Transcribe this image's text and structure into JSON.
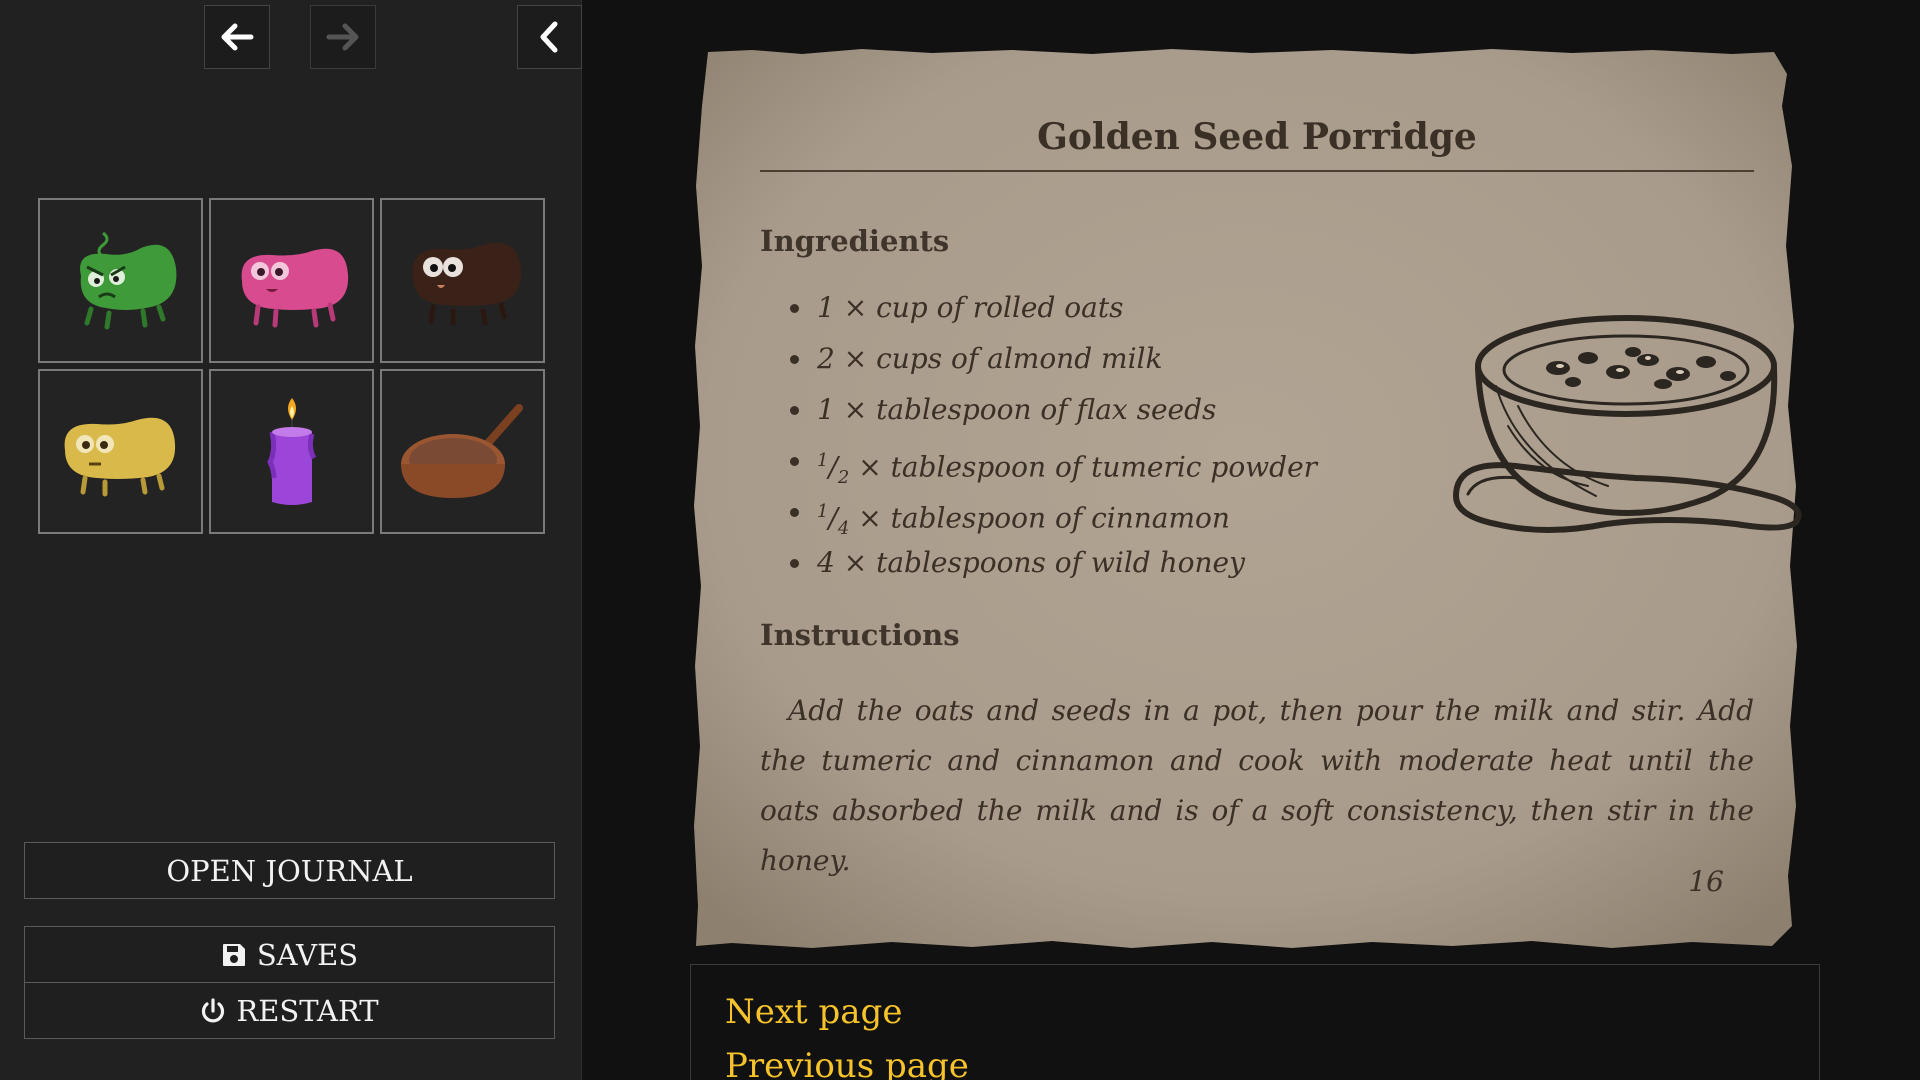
{
  "sidebar": {
    "nav": {
      "back_icon": "arrow-left-icon",
      "forward_icon": "arrow-right-icon",
      "collapse_icon": "chevron-left-icon"
    },
    "inventory": [
      {
        "name": "angry green bean",
        "icon": "green-bean-icon",
        "color": "#3f9a3a"
      },
      {
        "name": "pink bean",
        "icon": "pink-bean-icon",
        "color": "#d84b8f"
      },
      {
        "name": "dark brown bean",
        "icon": "brown-bean-icon",
        "color": "#3a2218"
      },
      {
        "name": "yellow bean",
        "icon": "yellow-bean-icon",
        "color": "#d9b94a"
      },
      {
        "name": "purple candle",
        "icon": "candle-icon",
        "color": "#9b45d9"
      },
      {
        "name": "frying pan",
        "icon": "pan-icon",
        "color": "#9a5630"
      }
    ],
    "buttons": {
      "journal": "OPEN JOURNAL",
      "saves": "SAVES",
      "restart": "RESTART"
    }
  },
  "recipe": {
    "title": "Golden Seed Porridge",
    "ingredients_heading": "Ingredients",
    "ingredients": [
      {
        "qty": "1",
        "rest": " × cup of rolled oats"
      },
      {
        "qty": "2",
        "rest": " × cups of almond milk"
      },
      {
        "qty": "1",
        "rest": " × tablespoon of flax seeds"
      },
      {
        "num": "1",
        "den": "2",
        "rest": " × tablespoon of tumeric powder"
      },
      {
        "num": "1",
        "den": "4",
        "rest": " × tablespoon of cinnamon"
      },
      {
        "qty": "4",
        "rest": " × tablespoons of wild honey"
      }
    ],
    "instructions_heading": "Instructions",
    "instructions": "Add the oats and seeds in a pot, then pour the milk and stir. Add the tumeric and cinnamon and cook with moderate heat until the oats absorbed the milk and is of a soft consistency, then stir in the honey.",
    "page_number": "16",
    "illustration": "porridge-bowl-icon",
    "paper_color": "#a99b8b"
  },
  "choices": {
    "next": "Next page",
    "previous": "Previous page",
    "link_color": "#f6c32a"
  }
}
